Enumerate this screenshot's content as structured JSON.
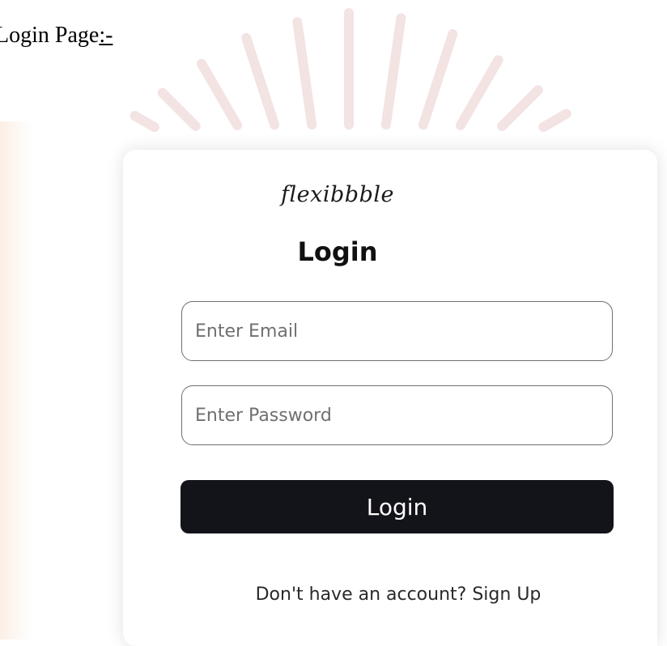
{
  "document": {
    "caption_text": "Login Page",
    "caption_suffix": ":-"
  },
  "card": {
    "brand_name": "flexibbble",
    "title": "Login",
    "email_placeholder": "Enter Email",
    "password_placeholder": "Enter Password",
    "login_button_label": "Login",
    "footer_prompt": "Don't have an account?",
    "signup_link_label": "Sign Up"
  },
  "colors": {
    "button_background": "#13131a",
    "button_text": "#ffffff",
    "input_border": "#6f6f6f",
    "card_background": "#ffffff"
  }
}
